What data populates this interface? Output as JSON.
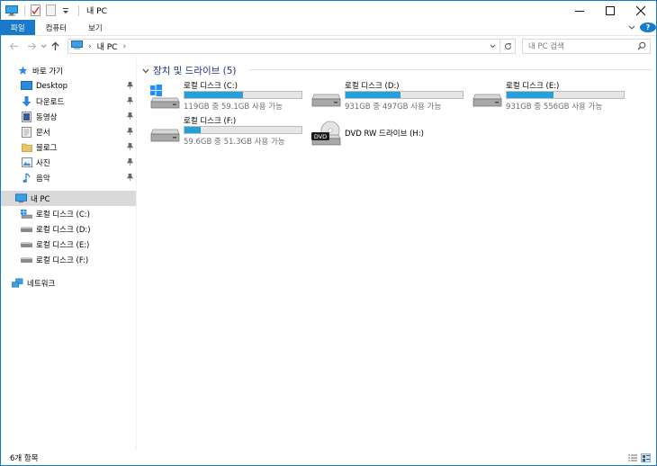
{
  "window": {
    "title": "내 PC"
  },
  "ribbon": {
    "tabs": [
      {
        "label": "파일"
      },
      {
        "label": "컴퓨터"
      },
      {
        "label": "보기"
      }
    ]
  },
  "address": {
    "crumbs": [
      "내 PC"
    ]
  },
  "search": {
    "placeholder": "내 PC 검색"
  },
  "navpane": {
    "quick_access": "바로 가기",
    "pinned": [
      {
        "label": "Desktop",
        "icon": "desktop-folder-icon"
      },
      {
        "label": "다운로드",
        "icon": "download-arrow-icon"
      },
      {
        "label": "동영상",
        "icon": "video-icon"
      },
      {
        "label": "문서",
        "icon": "document-icon"
      },
      {
        "label": "블로그",
        "icon": "folder-icon"
      },
      {
        "label": "사진",
        "icon": "picture-icon"
      },
      {
        "label": "음악",
        "icon": "music-icon"
      }
    ],
    "this_pc": "내 PC",
    "drives": [
      {
        "label": "로컬 디스크 (C:)"
      },
      {
        "label": "로컬 디스크 (D:)"
      },
      {
        "label": "로컬 디스크 (E:)"
      },
      {
        "label": "로컬 디스크 (F:)"
      }
    ],
    "network": "네트워크"
  },
  "content": {
    "group_title": "장치 및 드라이브 (5)",
    "drives": [
      {
        "name": "로컬 디스크 (C:)",
        "space": "119GB 중 59.1GB 사용 가능",
        "used_fraction": 0.5,
        "icon": "windows-drive-icon"
      },
      {
        "name": "로컬 디스크 (D:)",
        "space": "931GB 중 497GB 사용 가능",
        "used_fraction": 0.47,
        "icon": "hard-drive-icon"
      },
      {
        "name": "로컬 디스크 (E:)",
        "space": "931GB 중 556GB 사용 가능",
        "used_fraction": 0.4,
        "icon": "hard-drive-icon"
      },
      {
        "name": "로컬 디스크 (F:)",
        "space": "59.6GB 중 51.3GB 사용 가능",
        "used_fraction": 0.14,
        "icon": "hard-drive-icon"
      }
    ],
    "dvd": {
      "name": "DVD RW 드라이브 (H:)",
      "badge": "DVD"
    }
  },
  "status": {
    "count": "6개 항목"
  },
  "colors": {
    "accent": "#1979ca",
    "bar_fill": "#26a0da",
    "group_title": "#1e3287"
  }
}
